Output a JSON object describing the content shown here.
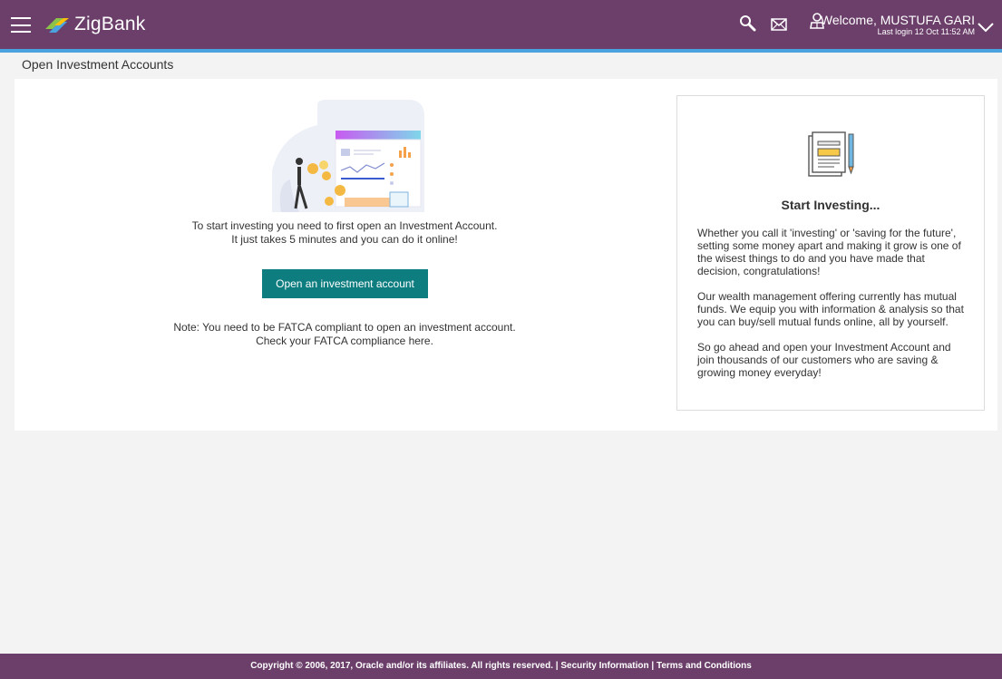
{
  "header": {
    "brand": "ZigBank",
    "welcome": "Welcome, MUSTUFA GARI",
    "last_login": "Last login 12 Oct 11:52 AM"
  },
  "page": {
    "title": "Open Investment Accounts"
  },
  "main": {
    "intro_line1": "To start investing you need to first open an Investment Account.",
    "intro_line2": "It just takes 5 minutes and you can do it online!",
    "open_button": "Open an investment account",
    "note_line1": "Note: You need to be FATCA compliant to open an investment account.",
    "note_line2": "Check your FATCA compliance here."
  },
  "side_panel": {
    "title": "Start Investing...",
    "paragraphs": [
      "Whether you call it 'investing' or 'saving for the future', setting some money apart and making it grow is one of the wisest things to do and you have made that decision, congratulations!",
      "Our wealth management offering currently has mutual funds. We equip you with information & analysis so that you can buy/sell mutual funds online, all by yourself.",
      "So go ahead and open your Investment Account and join thousands of our customers who are saving & growing money everyday!"
    ]
  },
  "footer": {
    "copyright": "Copyright © 2006, 2017, Oracle and/or its affiliates. All rights reserved.",
    "sep": " | ",
    "security": "Security Information",
    "terms": "Terms and Conditions"
  },
  "colors": {
    "header": "#6b3f6a",
    "accent_line": "#4aa3df",
    "button": "#0e7d80"
  },
  "icons": [
    "hamburger-icon",
    "zigbank-logo-icon",
    "search-icon",
    "mail-icon",
    "user-icon",
    "chevron-down-icon",
    "newspaper-icon"
  ]
}
